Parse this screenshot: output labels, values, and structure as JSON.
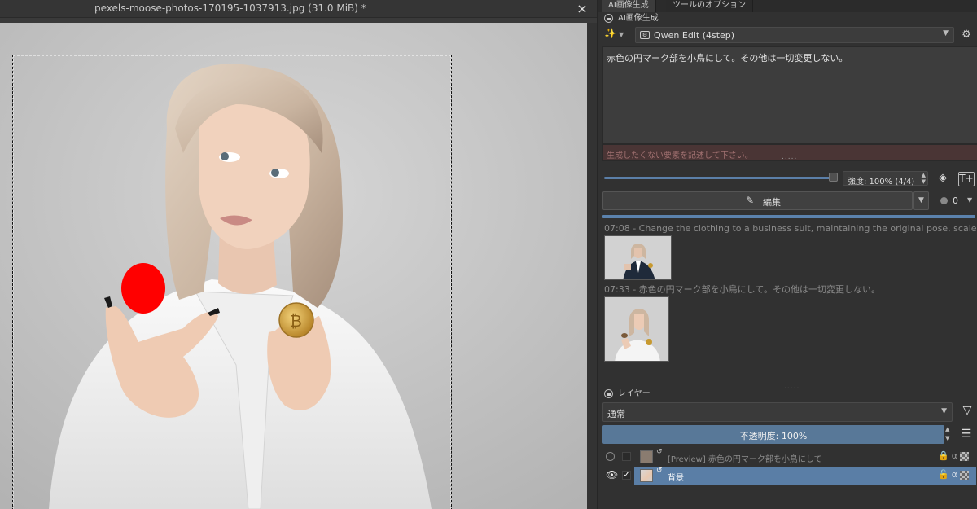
{
  "document": {
    "title": "pexels-moose-photos-170195-1037913.jpg (31.0 MiB) *",
    "close_icon": "×"
  },
  "dock_tabs": [
    "AI画像生成",
    "ツールのオプション"
  ],
  "ai_panel": {
    "header": "AI画像生成",
    "model": "Qwen Edit (4step)",
    "prompt": "赤色の円マーク部を小鳥にして。その他は一切変更しない。",
    "negative_placeholder": "生成したくない要素を記述して下さい。",
    "strength": {
      "label": "強度: 100% (4/4)",
      "value_fraction": 1.0
    },
    "edit_button": "編集",
    "seed_value": "0",
    "progress_fraction": 1.0,
    "history": [
      {
        "time": "07:08",
        "text": "Change the clothing to a business suit, maintaining the original pose, scale, and"
      },
      {
        "time": "07:33",
        "text": "赤色の円マーク部を小鳥にして。その他は一切変更しない。"
      }
    ]
  },
  "layers_panel": {
    "header": "レイヤー",
    "blend_mode": "通常",
    "opacity_label": "不透明度: 100%",
    "layers": [
      {
        "name": "[Preview] 赤色の円マーク部を小鳥にして",
        "visible": false,
        "selected": false
      },
      {
        "name": "背景",
        "visible": true,
        "selected": true
      }
    ],
    "alpha_glyph": "α"
  },
  "icons": {
    "close": "close-icon",
    "wand": "magic-wand-icon",
    "settings": "gear-icon",
    "filter": "filter-icon",
    "menu": "hamburger-menu-icon",
    "eye": "eye-icon",
    "lock": "lock-icon"
  },
  "colors": {
    "accent_blue": "#5a7ea6",
    "progress": "#5b82ad",
    "negative_bg": "#4a3535",
    "red_mark": "#ff0000"
  }
}
